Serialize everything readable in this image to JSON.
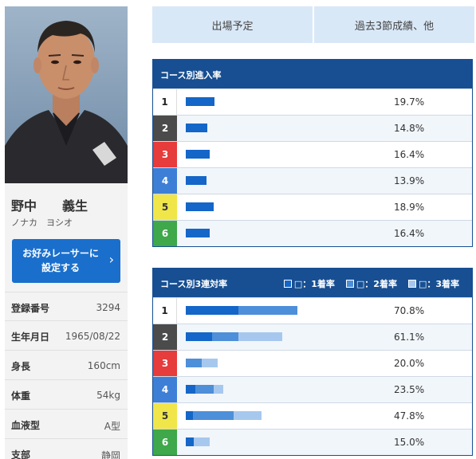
{
  "racer": {
    "name": "野中　　義生",
    "kana": "ノナカ　ヨシオ",
    "favorite_button": [
      "お好みレーサーに",
      "設定する"
    ],
    "info": [
      {
        "label": "登録番号",
        "value": "3294"
      },
      {
        "label": "生年月日",
        "value": "1965/08/22"
      },
      {
        "label": "身長",
        "value": "160cm"
      },
      {
        "label": "体重",
        "value": "54kg"
      },
      {
        "label": "血液型",
        "value": "A型"
      },
      {
        "label": "支部",
        "value": "静岡"
      }
    ]
  },
  "tabs": [
    "出場予定",
    "過去3節成績、他"
  ],
  "course_entry": {
    "title": "コース別進入率",
    "rows": [
      {
        "lane": "1",
        "rate": "19.7%",
        "value": 19.7
      },
      {
        "lane": "2",
        "rate": "14.8%",
        "value": 14.8
      },
      {
        "lane": "3",
        "rate": "16.4%",
        "value": 16.4
      },
      {
        "lane": "4",
        "rate": "13.9%",
        "value": 13.9
      },
      {
        "lane": "5",
        "rate": "18.9%",
        "value": 18.9
      },
      {
        "lane": "6",
        "rate": "16.4%",
        "value": 16.4
      }
    ]
  },
  "course_top3": {
    "title": "コース別3連対率",
    "legend": [
      "□：1着率",
      "□：2着率",
      "□：3着率"
    ],
    "colors": [
      "#1466c8",
      "#4d8fd9",
      "#a7c8ee"
    ],
    "rows": [
      {
        "lane": "1",
        "rate": "70.8%",
        "parts": [
          33.3,
          37.5,
          0
        ]
      },
      {
        "lane": "2",
        "rate": "61.1%",
        "parts": [
          16.7,
          16.7,
          27.7
        ]
      },
      {
        "lane": "3",
        "rate": "20.0%",
        "parts": [
          0,
          10.0,
          10.0
        ]
      },
      {
        "lane": "4",
        "rate": "23.5%",
        "parts": [
          5.9,
          11.8,
          5.8
        ]
      },
      {
        "lane": "5",
        "rate": "47.8%",
        "parts": [
          4.3,
          26.1,
          17.4
        ]
      },
      {
        "lane": "6",
        "rate": "15.0%",
        "parts": [
          5.0,
          0,
          10.0
        ]
      }
    ]
  },
  "entry_bar_color": "#1466c8"
}
